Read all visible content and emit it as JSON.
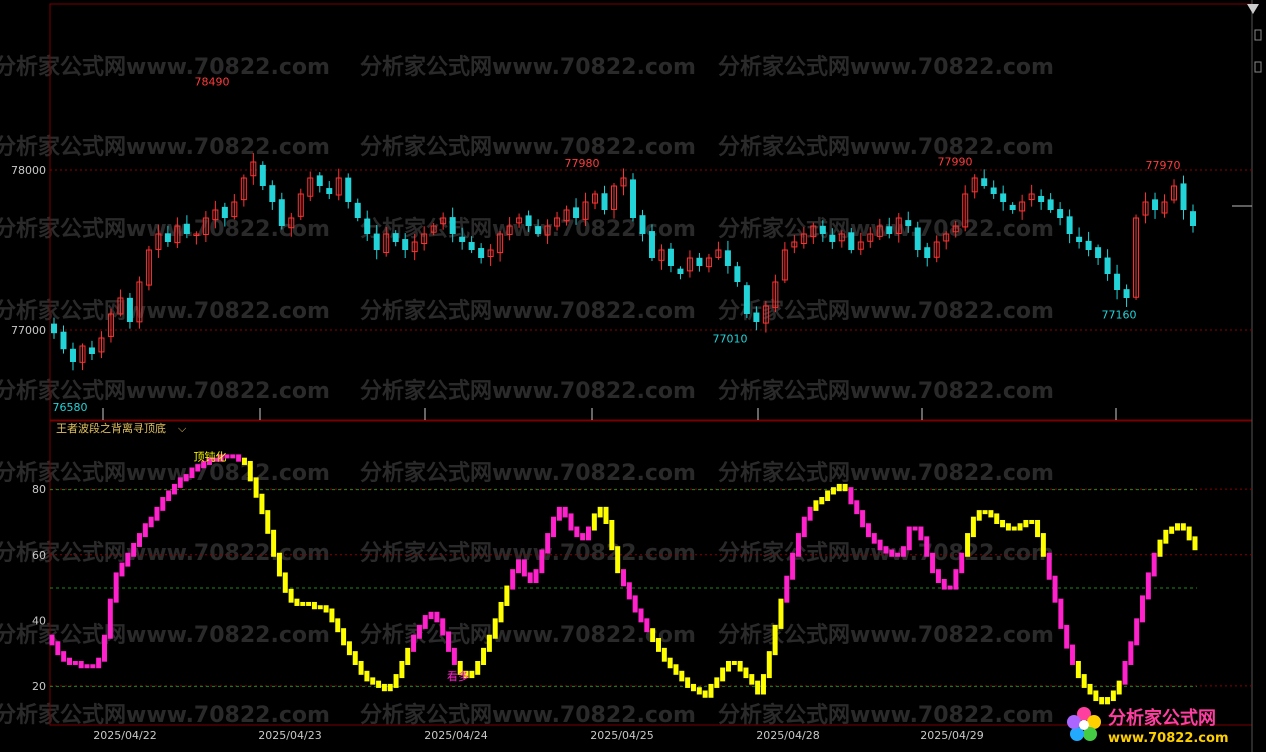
{
  "indicator_title": "王者波段之背离寻顶底",
  "indicator_caret": "⌵",
  "watermark": "分析家公式网www.70822.com",
  "logo": {
    "name": "分析家公式网",
    "url": "www.70822.com"
  },
  "colors": {
    "background": "#000000",
    "up_candle": "#ff3333",
    "down_candle": "#22d3d8",
    "price_label_high": "#ff3b3b",
    "price_label_low": "#22d3d8",
    "osc_pink": "#ff22cc",
    "osc_yellow": "#ffff00",
    "grid_red": "#8b0000",
    "grid_green": "#1a8a1a",
    "axis_text": "#c8c8c8",
    "title_text": "#e0c060"
  },
  "chart_data": [
    {
      "type": "candlestick",
      "title": "",
      "y_ticks": [
        77000,
        78000
      ],
      "ylim": [
        76450,
        79000
      ],
      "x_tick_labels": [
        "2025/04/22",
        "2025/04/23",
        "2025/04/24",
        "2025/04/25",
        "2025/04/28",
        "2025/04/29"
      ],
      "annotations": [
        {
          "text": "78490",
          "value": 78490,
          "kind": "high"
        },
        {
          "text": "77980",
          "value": 77980,
          "kind": "high"
        },
        {
          "text": "77990",
          "value": 77990,
          "kind": "high"
        },
        {
          "text": "77970",
          "value": 77970,
          "kind": "high"
        },
        {
          "text": "76580",
          "value": 76580,
          "kind": "low"
        },
        {
          "text": "77010",
          "value": 77010,
          "kind": "low"
        },
        {
          "text": "77160",
          "value": 77160,
          "kind": "low"
        }
      ],
      "close_path": [
        76980,
        76880,
        76800,
        76900,
        76850,
        76950,
        77100,
        77200,
        77050,
        77300,
        77500,
        77600,
        77550,
        77650,
        77600,
        77600,
        77700,
        77750,
        77700,
        77800,
        77950,
        78050,
        77900,
        77800,
        77650,
        77700,
        77850,
        77950,
        77900,
        77850,
        77950,
        77800,
        77700,
        77600,
        77500,
        77600,
        77550,
        77500,
        77550,
        77600,
        77650,
        77700,
        77600,
        77550,
        77500,
        77450,
        77500,
        77600,
        77650,
        77700,
        77650,
        77600,
        77650,
        77700,
        77750,
        77700,
        77800,
        77850,
        77750,
        77900,
        77950,
        77700,
        77600,
        77450,
        77500,
        77400,
        77350,
        77450,
        77400,
        77450,
        77500,
        77400,
        77300,
        77100,
        77050,
        77150,
        77300,
        77500,
        77550,
        77600,
        77650,
        77600,
        77550,
        77600,
        77500,
        77550,
        77600,
        77650,
        77600,
        77700,
        77650,
        77500,
        77450,
        77550,
        77600,
        77650,
        77850,
        77950,
        77900,
        77850,
        77800,
        77750,
        77800,
        77850,
        77800,
        77750,
        77700,
        77600,
        77550,
        77500,
        77450,
        77350,
        77250,
        77200,
        77700,
        77800,
        77750,
        77800,
        77900,
        77750,
        77650
      ]
    },
    {
      "type": "line",
      "title": "王者波段之背离寻顶底",
      "y_ticks": [
        20,
        40,
        60,
        80
      ],
      "ylim": [
        9,
        95
      ],
      "reference_lines": {
        "red": [
          20,
          60,
          80
        ],
        "green": [
          20,
          50,
          80
        ]
      },
      "annotations": [
        {
          "text": "顶钝化",
          "value": 90
        },
        {
          "text": "看多",
          "value": 23
        }
      ],
      "series": [
        {
          "values": [
            33,
            30,
            28,
            27,
            27,
            26,
            26,
            26,
            28,
            35,
            46,
            54,
            57,
            60,
            63,
            66,
            69,
            71,
            74,
            77,
            79,
            81,
            83,
            84,
            86,
            87,
            88,
            89,
            89,
            90,
            90,
            90,
            89,
            88,
            83,
            78,
            73,
            67,
            60,
            54,
            49,
            46,
            45,
            45,
            45,
            44,
            44,
            43,
            40,
            37,
            33,
            30,
            27,
            24,
            22,
            21,
            20,
            19,
            20,
            23,
            27,
            31,
            35,
            38,
            41,
            42,
            40,
            36,
            31,
            27,
            24,
            23,
            24,
            27,
            31,
            35,
            40,
            45,
            50,
            55,
            58,
            54,
            52,
            55,
            61,
            66,
            71,
            74,
            72,
            68,
            66,
            65,
            68,
            72,
            74,
            70,
            62,
            55,
            51,
            47,
            43,
            40,
            37,
            34,
            31,
            28,
            26,
            24,
            22,
            20,
            19,
            18,
            17,
            20,
            22,
            25,
            27,
            27,
            25,
            23,
            21,
            18,
            23,
            30,
            38,
            46,
            53,
            60,
            66,
            71,
            74,
            76,
            77,
            79,
            80,
            81,
            80,
            76,
            73,
            69,
            66,
            64,
            62,
            61,
            60,
            60,
            62,
            68,
            68,
            65,
            60,
            55,
            52,
            50,
            50,
            55,
            60,
            66,
            71,
            73,
            73,
            72,
            70,
            69,
            68,
            68,
            69,
            70,
            70,
            66,
            60,
            53,
            46,
            38,
            32,
            27,
            23,
            20,
            18,
            16,
            15,
            16,
            18,
            21,
            27,
            33,
            40,
            47,
            54,
            60,
            64,
            67,
            68,
            69,
            68,
            65,
            62
          ],
          "colors": "PPPPPPPPPPPPPPPPPPPPPPPPPPPPPPPPPYYYYYYYYYYYYYYYYYYYYYYYYYYYYYPPPPPPPPYYYYYYYYYPPPPPPPPPPPPPPYYYYYPPPPPYYYYYYYYYYYYYYYYYYYYYYYPPPPPYYYYYYPPPPPPPPPPPPPPPPPPPPYYYYYYYYYYYYYYPPPPPYYYYYYYYPPPPPPYYYYYYYYYYYYYYYYYYYYYYYYYYPPPPPPPPPPPPPPPPPPYYY"
        }
      ]
    }
  ]
}
